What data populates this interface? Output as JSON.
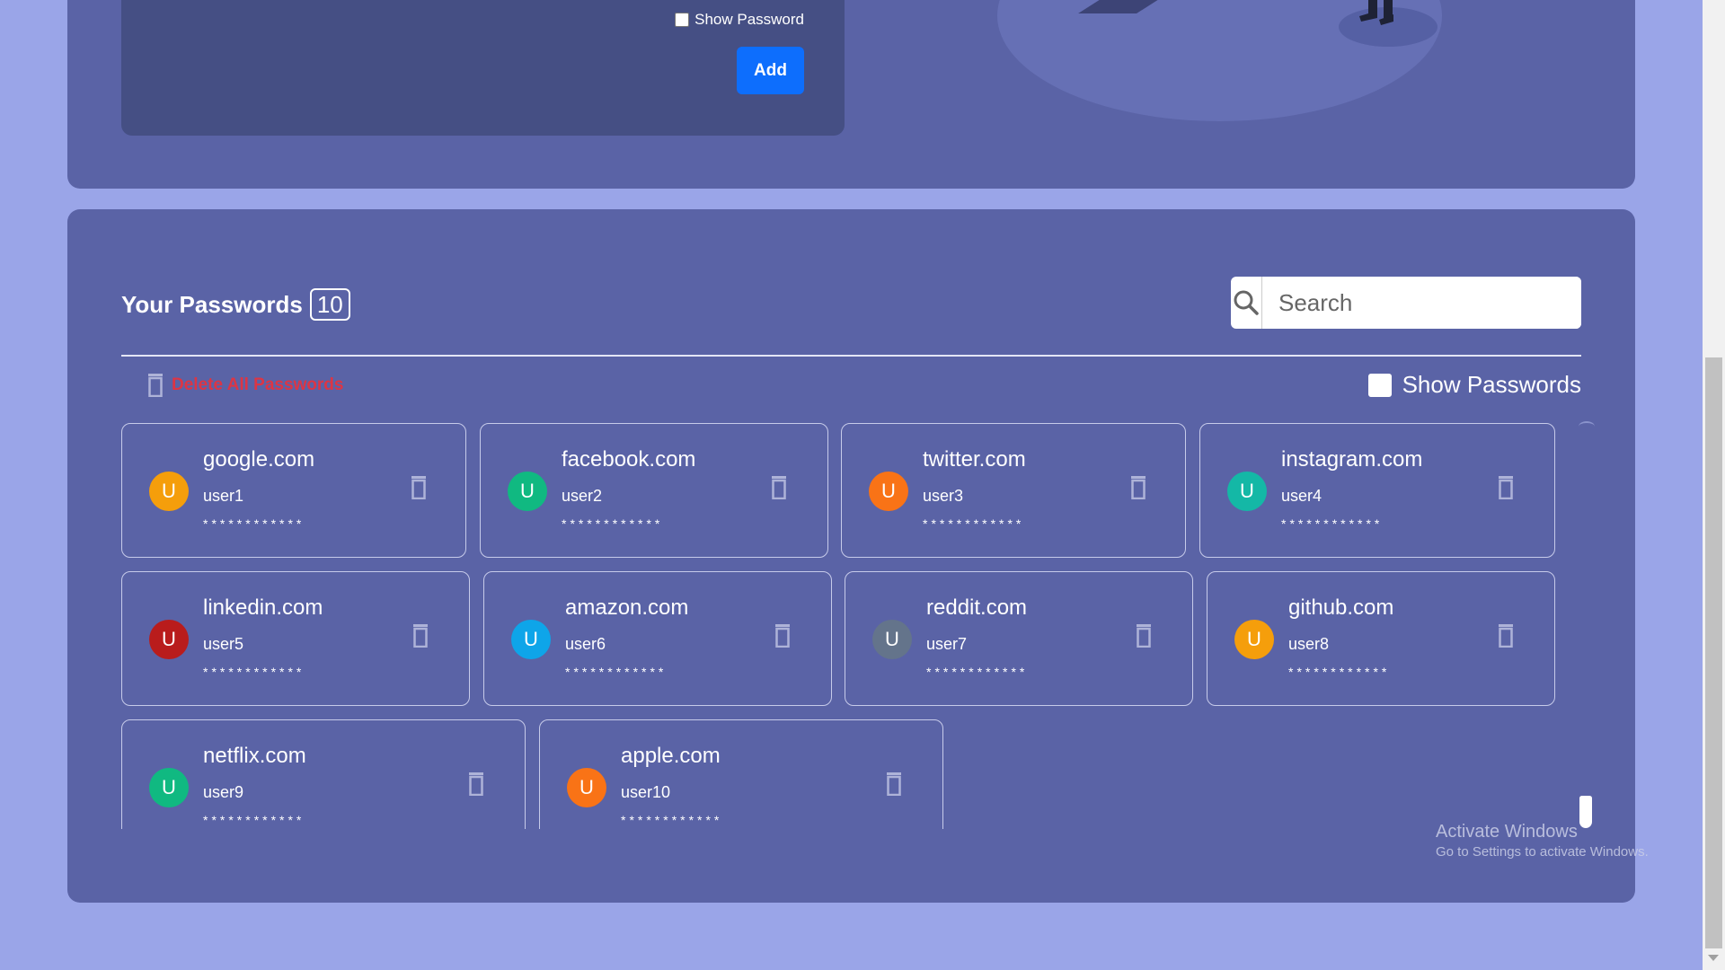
{
  "add_form": {
    "show_password_label": "Show Password",
    "add_label": "Add"
  },
  "passwords_section": {
    "title": "Your Passwords",
    "count": "10",
    "search_placeholder": "Search",
    "delete_all_label": "Delete All Passwords",
    "show_passwords_label": "Show Passwords",
    "entries": [
      {
        "avatar": "U",
        "site": "google.com",
        "user": "user1",
        "masked": "************",
        "avatar_color": "#f59e0b"
      },
      {
        "avatar": "U",
        "site": "facebook.com",
        "user": "user2",
        "masked": "************",
        "avatar_color": "#10b981"
      },
      {
        "avatar": "U",
        "site": "twitter.com",
        "user": "user3",
        "masked": "************",
        "avatar_color": "#f97316"
      },
      {
        "avatar": "U",
        "site": "instagram.com",
        "user": "user4",
        "masked": "************",
        "avatar_color": "#14b8a6"
      },
      {
        "avatar": "U",
        "site": "linkedin.com",
        "user": "user5",
        "masked": "************",
        "avatar_color": "#b91c1c"
      },
      {
        "avatar": "U",
        "site": "amazon.com",
        "user": "user6",
        "masked": "************",
        "avatar_color": "#0ea5e9"
      },
      {
        "avatar": "U",
        "site": "reddit.com",
        "user": "user7",
        "masked": "************",
        "avatar_color": "#64748b"
      },
      {
        "avatar": "U",
        "site": "github.com",
        "user": "user8",
        "masked": "************",
        "avatar_color": "#f59e0b"
      },
      {
        "avatar": "U",
        "site": "netflix.com",
        "user": "user9",
        "masked": "************",
        "avatar_color": "#10b981"
      },
      {
        "avatar": "U",
        "site": "apple.com",
        "user": "user10",
        "masked": "************",
        "avatar_color": "#f97316"
      }
    ]
  },
  "watermark": {
    "line1": "Activate Windows",
    "line2": "Go to Settings to activate Windows."
  },
  "colors": {
    "page_bg": "#9aa5e8",
    "panel_bg": "#5a63a6",
    "form_bg": "#454f84",
    "accent": "#0d6efd",
    "danger": "#dc3545"
  }
}
